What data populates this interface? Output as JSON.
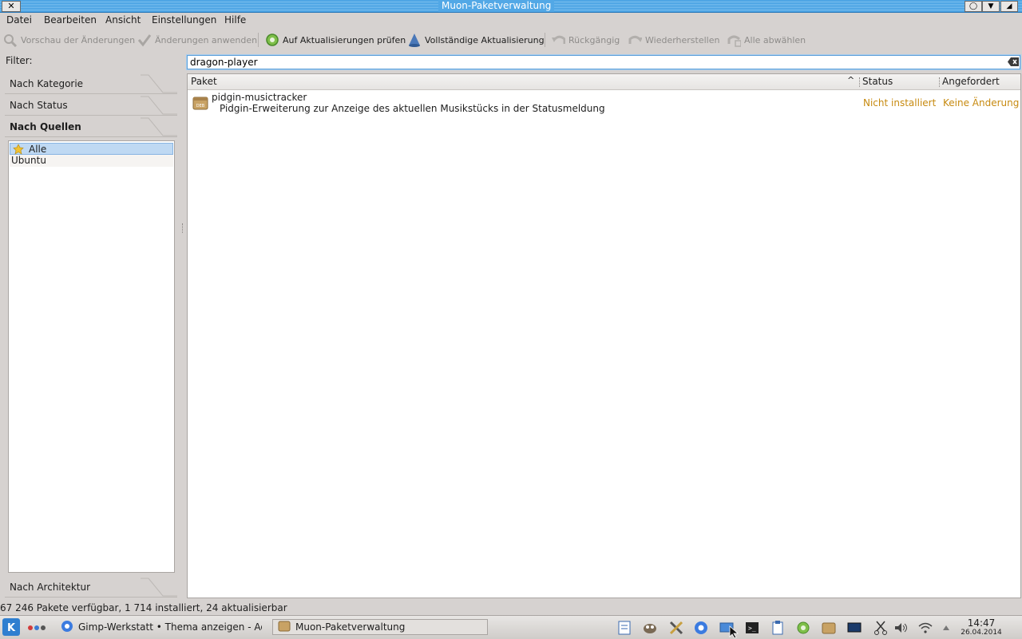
{
  "window": {
    "title": "Muon-Paketverwaltung",
    "close_glyph": "✕"
  },
  "menubar": {
    "items": [
      "Datei",
      "Bearbeiten",
      "Ansicht",
      "Einstellungen",
      "Hilfe"
    ]
  },
  "toolbar": {
    "preview": "Vorschau der Änderungen",
    "apply": "Änderungen anwenden",
    "check_updates": "Auf Aktualisierungen prüfen",
    "full_upgrade": "Vollständige Aktualisierung",
    "undo": "Rückgängig",
    "redo": "Wiederherstellen",
    "deselect_all": "Alle abwählen"
  },
  "filter": {
    "label": "Filter:",
    "by_category": "Nach Kategorie",
    "by_status": "Nach Status",
    "by_sources": "Nach Quellen",
    "by_architecture": "Nach Architektur",
    "sources": [
      "Alle",
      "Ubuntu"
    ],
    "selected_source": "Alle"
  },
  "search": {
    "value": "dragon-player"
  },
  "table": {
    "columns": {
      "package": "Paket",
      "status": "Status",
      "requested": "Angefordert"
    },
    "rows": [
      {
        "name": "pidgin-musictracker",
        "description": "Pidgin-Erweiterung zur Anzeige des aktuellen Musikstücks in der Statusmeldung",
        "status": "Nicht installiert",
        "requested": "Keine Änderung"
      }
    ]
  },
  "statusbar": {
    "text": "67 246 Pakete verfügbar, 1 714 installiert, 24 aktualisierbar"
  },
  "taskbar": {
    "tasks": [
      "Gimp-Werkstatt • Thema anzeigen - Adobe",
      "Muon-Paketverwaltung"
    ],
    "clock": {
      "time": "14:47",
      "date": "26.04.2014"
    }
  },
  "icons": {
    "kde": "kde-menu-icon",
    "deb": "deb-package-icon"
  },
  "colors": {
    "titlebar": "#3d9be0",
    "status_text": "#c78a10",
    "selection": "#bfd9f3"
  }
}
